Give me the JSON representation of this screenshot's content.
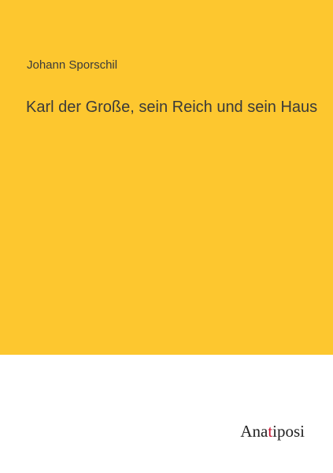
{
  "cover": {
    "author": "Johann Sporschil",
    "title": "Karl der Große, sein Reich und sein Haus",
    "background_color": "#fdc72f",
    "text_color": "#3a3a3a"
  },
  "publisher": {
    "name_start": "Ana",
    "name_accent": "t",
    "name_end": "iposi",
    "accent_color": "#c8102e"
  }
}
